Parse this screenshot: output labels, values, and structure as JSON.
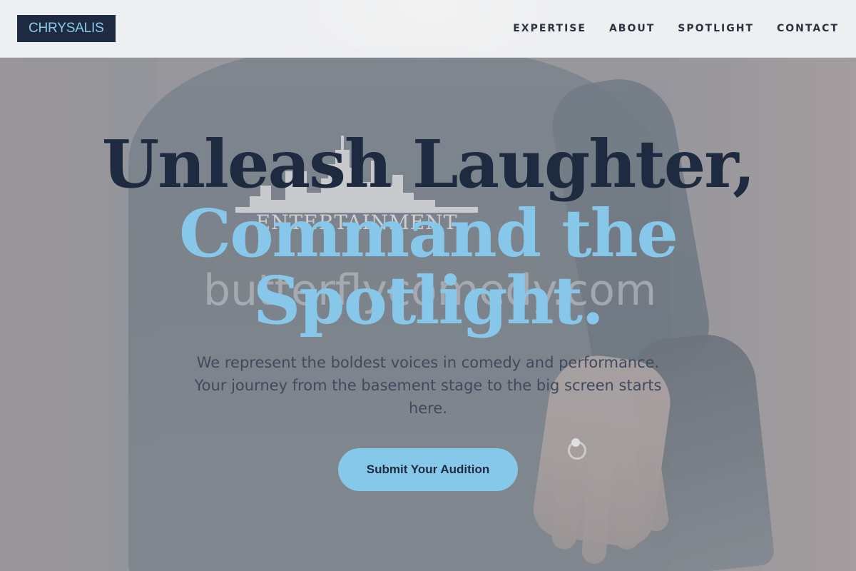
{
  "brand": {
    "logo": "CHRYSALIS"
  },
  "nav": {
    "items": [
      {
        "label": "EXPERTISE"
      },
      {
        "label": "ABOUT"
      },
      {
        "label": "SPOTLIGHT"
      },
      {
        "label": "CONTACT"
      }
    ]
  },
  "hero": {
    "headline_line1": "Unleash Laughter,",
    "headline_line2": "Command the Spotlight.",
    "subtext": "We represent the boldest voices in comedy and performance. Your journey from the basement stage to the big screen starts here.",
    "cta_label": "Submit Your Audition"
  },
  "background_photo": {
    "shirt_print_text": "ENTERTAINMENT",
    "watermark_text": "butterflycomedy.com"
  },
  "colors": {
    "navy": "#1d2a40",
    "accent_blue": "#87c8ea",
    "subtext": "#3f4a5e"
  }
}
